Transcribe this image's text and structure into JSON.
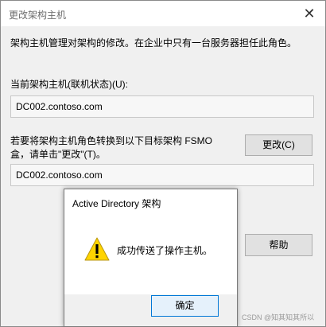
{
  "main_dialog": {
    "title": "更改架构主机",
    "close_glyph": "✕",
    "description": "架构主机管理对架构的修改。在企业中只有一台服务器担任此角色。",
    "current_master_label": "当前架构主机(联机状态)(U):",
    "current_master_value": "DC002.contoso.com",
    "transfer_label": "若要将架构主机角色转换到以下目标架构 FSMO 盒，请单击\"更改\"(T)。",
    "target_value": "DC002.contoso.com",
    "change_button": "更改(C)",
    "help_button": "帮助"
  },
  "message_box": {
    "title": "Active Directory 架构",
    "message": "成功传送了操作主机。",
    "icon": "warning-icon",
    "ok_button": "确定"
  },
  "watermark": "CSDN @知其知其所以",
  "colors": {
    "dialog_bg": "#f0f0f0",
    "ok_border": "#0078d7",
    "warning_yellow": "#ffd400"
  }
}
